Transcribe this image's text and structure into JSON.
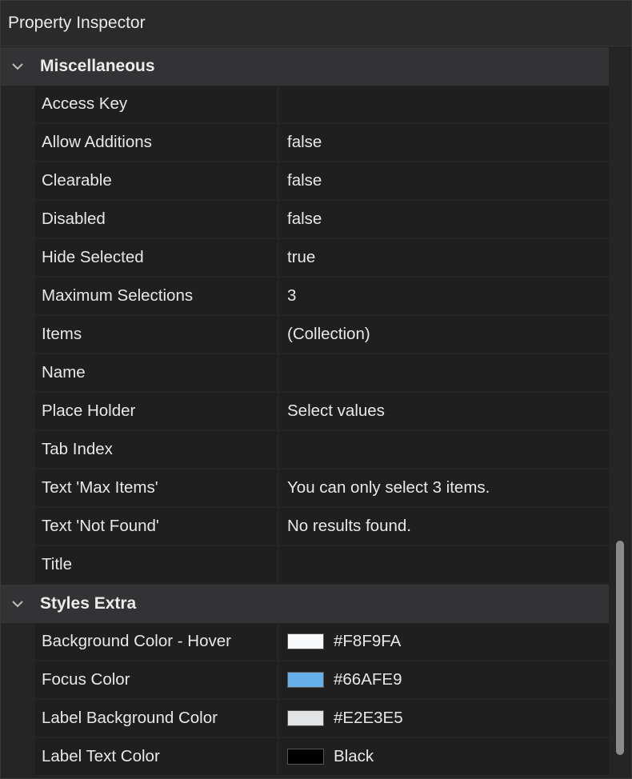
{
  "panel": {
    "title": "Property Inspector"
  },
  "sections": [
    {
      "label": "Miscellaneous",
      "expanded": true,
      "rows": [
        {
          "name": "Access Key",
          "value": ""
        },
        {
          "name": "Allow Additions",
          "value": "false"
        },
        {
          "name": "Clearable",
          "value": "false"
        },
        {
          "name": "Disabled",
          "value": "false"
        },
        {
          "name": "Hide Selected",
          "value": "true"
        },
        {
          "name": "Maximum Selections",
          "value": "3"
        },
        {
          "name": "Items",
          "value": "(Collection)"
        },
        {
          "name": "Name",
          "value": ""
        },
        {
          "name": "Place Holder",
          "value": "Select values"
        },
        {
          "name": "Tab Index",
          "value": ""
        },
        {
          "name": "Text 'Max Items'",
          "value": "You can only select 3 items."
        },
        {
          "name": "Text 'Not Found'",
          "value": "No results found."
        },
        {
          "name": "Title",
          "value": ""
        }
      ]
    },
    {
      "label": "Styles Extra",
      "expanded": true,
      "rows": [
        {
          "name": "Background Color - Hover",
          "value": "#F8F9FA",
          "swatch": "#F8F9FA"
        },
        {
          "name": "Focus Color",
          "value": "#66AFE9",
          "swatch": "#66AFE9"
        },
        {
          "name": "Label Background Color",
          "value": "#E2E3E5",
          "swatch": "#E2E3E5"
        },
        {
          "name": "Label Text Color",
          "value": "Black",
          "swatch": "#000000"
        }
      ]
    }
  ],
  "icons": {
    "section_toggle": "chevron-down-icon"
  }
}
